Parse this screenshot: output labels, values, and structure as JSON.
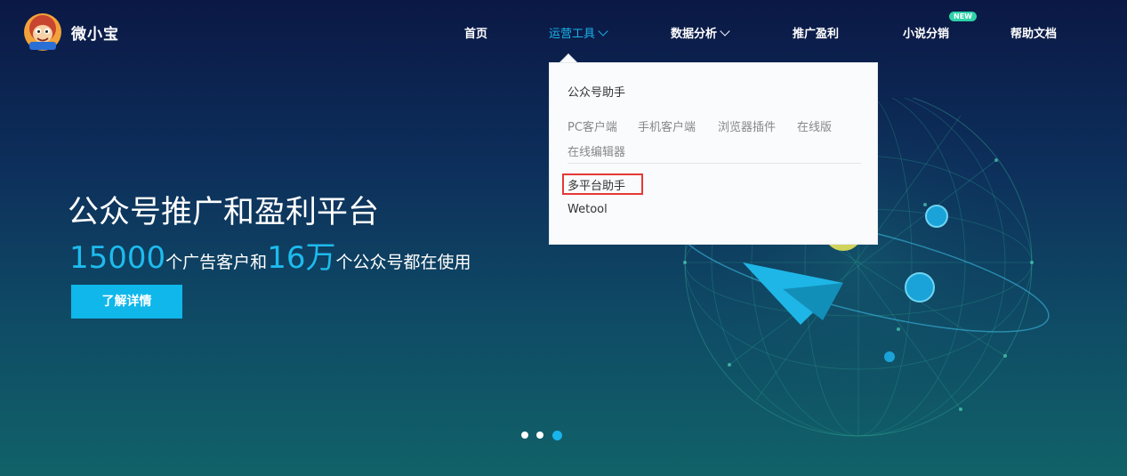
{
  "brand": {
    "name": "微小宝"
  },
  "nav": {
    "items": [
      {
        "label": "首页"
      },
      {
        "label": "运营工具"
      },
      {
        "label": "数据分析"
      },
      {
        "label": "推广盈利"
      },
      {
        "label": "小说分销"
      },
      {
        "label": "帮助文档"
      }
    ],
    "new_badge": "NEW"
  },
  "dropdown": {
    "group1_title": "公众号助手",
    "group1_links": [
      "PC客户端",
      "手机客户端",
      "浏览器插件",
      "在线版",
      "在线编辑器"
    ],
    "group2_title": "多平台助手",
    "group3_title": "Wetool"
  },
  "hero": {
    "title": "公众号推广和盈利平台",
    "num1": "15000",
    "text1": "个广告客户和",
    "num2": "16万",
    "text2": "个公众号都在使用",
    "cta_label": "了解详情"
  },
  "colors": {
    "accent": "#19b4ea",
    "highlight": "#e53935",
    "badge": "#2fd3a8"
  },
  "carousel": {
    "slides": 3,
    "active_index": 2
  }
}
